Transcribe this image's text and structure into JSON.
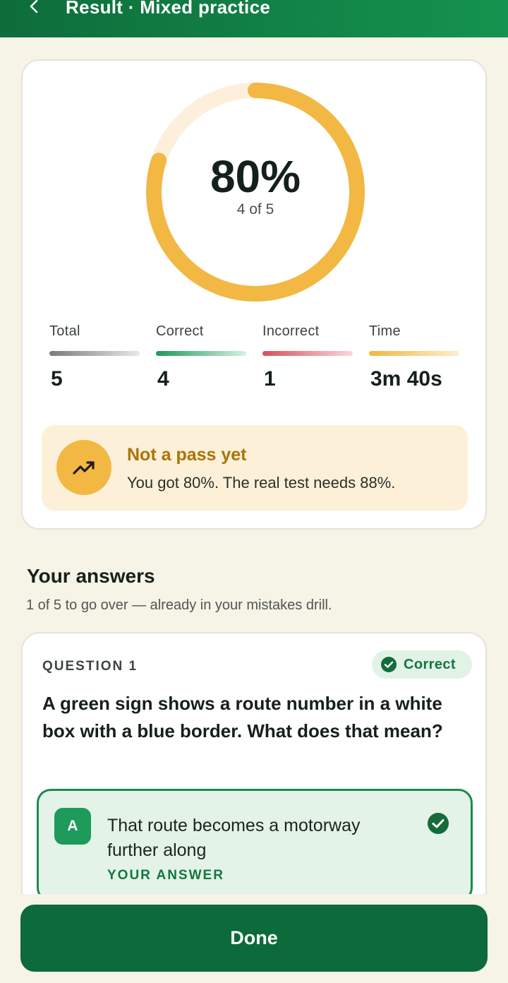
{
  "header": {
    "title": "Result · Mixed practice",
    "back_icon": "chevron-left-icon"
  },
  "score": {
    "percent_label": "80%",
    "fraction_label": "4 of 5",
    "fraction_value": 0.8,
    "ring_color": "#f2b843",
    "ring_track_color": "#fcf0dc"
  },
  "stats": [
    {
      "label": "Total",
      "value": "5",
      "color": "#7a7c7a"
    },
    {
      "label": "Correct",
      "value": "4",
      "color": "#1d9a5a"
    },
    {
      "label": "Incorrect",
      "value": "1",
      "color": "#d9505a"
    },
    {
      "label": "Time",
      "value": "3m 40s",
      "color": "#f1b83f"
    }
  ],
  "pass_status": {
    "title": "Not a pass yet",
    "message": "You got 80%. The real test needs 88%.",
    "icon": "trending-up-icon"
  },
  "answers": {
    "heading": "Your answers",
    "subheading": "1 of 5 to go over — already in your mistakes drill."
  },
  "question": {
    "label": "QUESTION 1",
    "status": "Correct",
    "text": "A green sign shows a route number in a white box with a blue border. What does that mean?",
    "option": {
      "letter": "A",
      "text": "That route becomes a motorway further along",
      "tag": "YOUR ANSWER"
    }
  },
  "footer": {
    "done_label": "Done"
  }
}
